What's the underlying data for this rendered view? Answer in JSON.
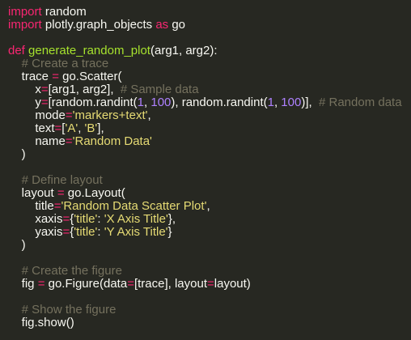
{
  "colors": {
    "background": "#272822",
    "text": "#f8f8f2",
    "keyword": "#f92672",
    "function_name": "#a6e22e",
    "string": "#e6db74",
    "number": "#ae81ff",
    "comment": "#75715e"
  },
  "editor": {
    "lines": [
      {
        "tokens": [
          {
            "t": "kw",
            "v": "import"
          },
          {
            "t": "id",
            "v": " random"
          }
        ]
      },
      {
        "tokens": [
          {
            "t": "kw",
            "v": "import"
          },
          {
            "t": "id",
            "v": " plotly.graph_objects "
          },
          {
            "t": "kw",
            "v": "as"
          },
          {
            "t": "id",
            "v": " go"
          }
        ]
      },
      {
        "tokens": []
      },
      {
        "tokens": [
          {
            "t": "kw",
            "v": "def"
          },
          {
            "t": "id",
            "v": " "
          },
          {
            "t": "fn",
            "v": "generate_random_plot"
          },
          {
            "t": "id",
            "v": "(arg1, arg2):"
          }
        ]
      },
      {
        "tokens": [
          {
            "t": "id",
            "v": "    "
          },
          {
            "t": "cmt",
            "v": "# Create a trace"
          }
        ]
      },
      {
        "tokens": [
          {
            "t": "id",
            "v": "    trace "
          },
          {
            "t": "op",
            "v": "="
          },
          {
            "t": "id",
            "v": " go.Scatter("
          }
        ]
      },
      {
        "tokens": [
          {
            "t": "id",
            "v": "        x"
          },
          {
            "t": "op",
            "v": "="
          },
          {
            "t": "id",
            "v": "[arg1, arg2],  "
          },
          {
            "t": "cmt",
            "v": "# Sample data"
          }
        ]
      },
      {
        "tokens": [
          {
            "t": "id",
            "v": "        y"
          },
          {
            "t": "op",
            "v": "="
          },
          {
            "t": "id",
            "v": "[random.randint("
          },
          {
            "t": "num",
            "v": "1"
          },
          {
            "t": "id",
            "v": ", "
          },
          {
            "t": "num",
            "v": "100"
          },
          {
            "t": "id",
            "v": "), random.randint("
          },
          {
            "t": "num",
            "v": "1"
          },
          {
            "t": "id",
            "v": ", "
          },
          {
            "t": "num",
            "v": "100"
          },
          {
            "t": "id",
            "v": ")],  "
          },
          {
            "t": "cmt",
            "v": "# Random data"
          }
        ]
      },
      {
        "tokens": [
          {
            "t": "id",
            "v": "        mode"
          },
          {
            "t": "op",
            "v": "="
          },
          {
            "t": "str",
            "v": "'markers+text'"
          },
          {
            "t": "id",
            "v": ","
          }
        ]
      },
      {
        "tokens": [
          {
            "t": "id",
            "v": "        text"
          },
          {
            "t": "op",
            "v": "="
          },
          {
            "t": "id",
            "v": "["
          },
          {
            "t": "str",
            "v": "'A'"
          },
          {
            "t": "id",
            "v": ", "
          },
          {
            "t": "str",
            "v": "'B'"
          },
          {
            "t": "id",
            "v": "],"
          }
        ]
      },
      {
        "tokens": [
          {
            "t": "id",
            "v": "        name"
          },
          {
            "t": "op",
            "v": "="
          },
          {
            "t": "str",
            "v": "'Random Data'"
          }
        ]
      },
      {
        "tokens": [
          {
            "t": "id",
            "v": "    )"
          }
        ]
      },
      {
        "tokens": []
      },
      {
        "tokens": [
          {
            "t": "id",
            "v": "    "
          },
          {
            "t": "cmt",
            "v": "# Define layout"
          }
        ]
      },
      {
        "tokens": [
          {
            "t": "id",
            "v": "    layout "
          },
          {
            "t": "op",
            "v": "="
          },
          {
            "t": "id",
            "v": " go.Layout("
          }
        ]
      },
      {
        "tokens": [
          {
            "t": "id",
            "v": "        title"
          },
          {
            "t": "op",
            "v": "="
          },
          {
            "t": "str",
            "v": "'Random Data Scatter Plot'"
          },
          {
            "t": "id",
            "v": ","
          }
        ]
      },
      {
        "tokens": [
          {
            "t": "id",
            "v": "        xaxis"
          },
          {
            "t": "op",
            "v": "="
          },
          {
            "t": "id",
            "v": "{"
          },
          {
            "t": "str",
            "v": "'title'"
          },
          {
            "t": "id",
            "v": ": "
          },
          {
            "t": "str",
            "v": "'X Axis Title'"
          },
          {
            "t": "id",
            "v": "},"
          }
        ]
      },
      {
        "tokens": [
          {
            "t": "id",
            "v": "        yaxis"
          },
          {
            "t": "op",
            "v": "="
          },
          {
            "t": "id",
            "v": "{"
          },
          {
            "t": "str",
            "v": "'title'"
          },
          {
            "t": "id",
            "v": ": "
          },
          {
            "t": "str",
            "v": "'Y Axis Title'"
          },
          {
            "t": "id",
            "v": "}"
          }
        ]
      },
      {
        "tokens": [
          {
            "t": "id",
            "v": "    )"
          }
        ]
      },
      {
        "tokens": []
      },
      {
        "tokens": [
          {
            "t": "id",
            "v": "    "
          },
          {
            "t": "cmt",
            "v": "# Create the figure"
          }
        ]
      },
      {
        "tokens": [
          {
            "t": "id",
            "v": "    fig "
          },
          {
            "t": "op",
            "v": "="
          },
          {
            "t": "id",
            "v": " go.Figure(data"
          },
          {
            "t": "op",
            "v": "="
          },
          {
            "t": "id",
            "v": "[trace], layout"
          },
          {
            "t": "op",
            "v": "="
          },
          {
            "t": "id",
            "v": "layout)"
          }
        ]
      },
      {
        "tokens": []
      },
      {
        "tokens": [
          {
            "t": "id",
            "v": "    "
          },
          {
            "t": "cmt",
            "v": "# Show the figure"
          }
        ]
      },
      {
        "tokens": [
          {
            "t": "id",
            "v": "    fig.show()"
          }
        ]
      }
    ]
  }
}
